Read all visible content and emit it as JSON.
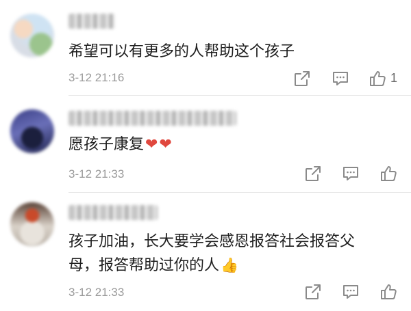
{
  "comments": [
    {
      "author": "",
      "text": "希望可以有更多的人帮助这个孩子",
      "time": "3-12 21:16",
      "likes": "1",
      "avatar_icon": "avatar-icon"
    },
    {
      "author": "",
      "text": "愿孩子康复",
      "emoji": [
        "❤",
        "❤"
      ],
      "time": "3-12 21:33",
      "likes": "",
      "avatar_icon": "avatar-icon"
    },
    {
      "author": "",
      "text_line1": "孩子加油，长大要学会感恩报答社会报答父",
      "text_line2": "母，报答帮助过你的人",
      "emoji": "👍",
      "time": "3-12 21:33",
      "likes": "",
      "avatar_icon": "avatar-icon"
    }
  ],
  "icons": {
    "share": "share-icon",
    "reply": "reply-icon",
    "like": "thumbs-up-icon"
  },
  "colors": {
    "text": "#1e1e1e",
    "meta": "#9a9a9a",
    "icon": "#8a8a8a",
    "heart": "#e0483e"
  }
}
